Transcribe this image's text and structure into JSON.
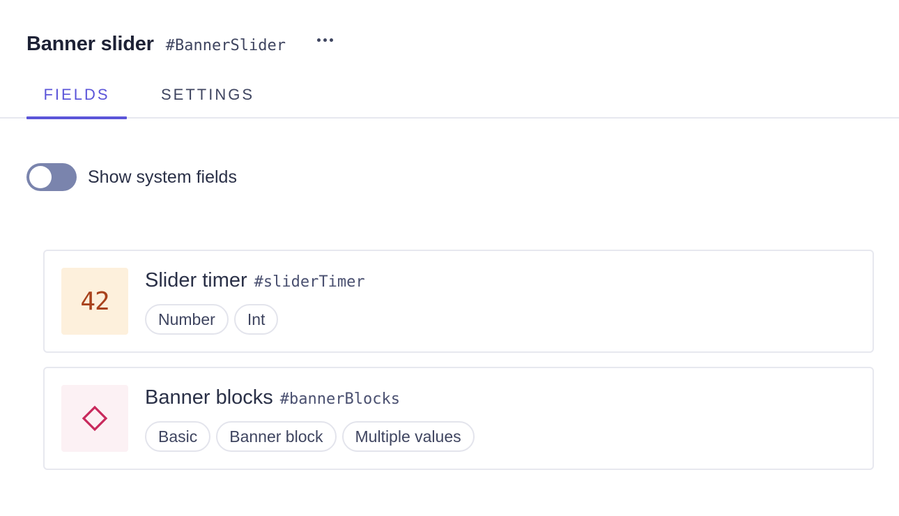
{
  "header": {
    "title": "Banner slider",
    "api_id": "#BannerSlider",
    "more_icon": "more-horizontal-icon"
  },
  "tabs": [
    {
      "label": "FIELDS",
      "active": true
    },
    {
      "label": "SETTINGS",
      "active": false
    }
  ],
  "system_fields_toggle": {
    "label": "Show system fields",
    "on": false
  },
  "fields": [
    {
      "name": "Slider timer",
      "api_id": "#sliderTimer",
      "icon": {
        "name": "number-icon",
        "glyph": "42",
        "background": "#fdf0dc",
        "color": "#a8421c"
      },
      "badges": [
        "Number",
        "Int"
      ]
    },
    {
      "name": "Banner blocks",
      "api_id": "#bannerBlocks",
      "icon": {
        "name": "component-diamond-icon",
        "background": "#fcf1f4",
        "color": "#c8295c"
      },
      "badges": [
        "Basic",
        "Banner block",
        "Multiple values"
      ]
    }
  ],
  "colors": {
    "accent": "#5b55d9",
    "toggle_off": "#7a84ad",
    "border": "#e7e8ef"
  }
}
